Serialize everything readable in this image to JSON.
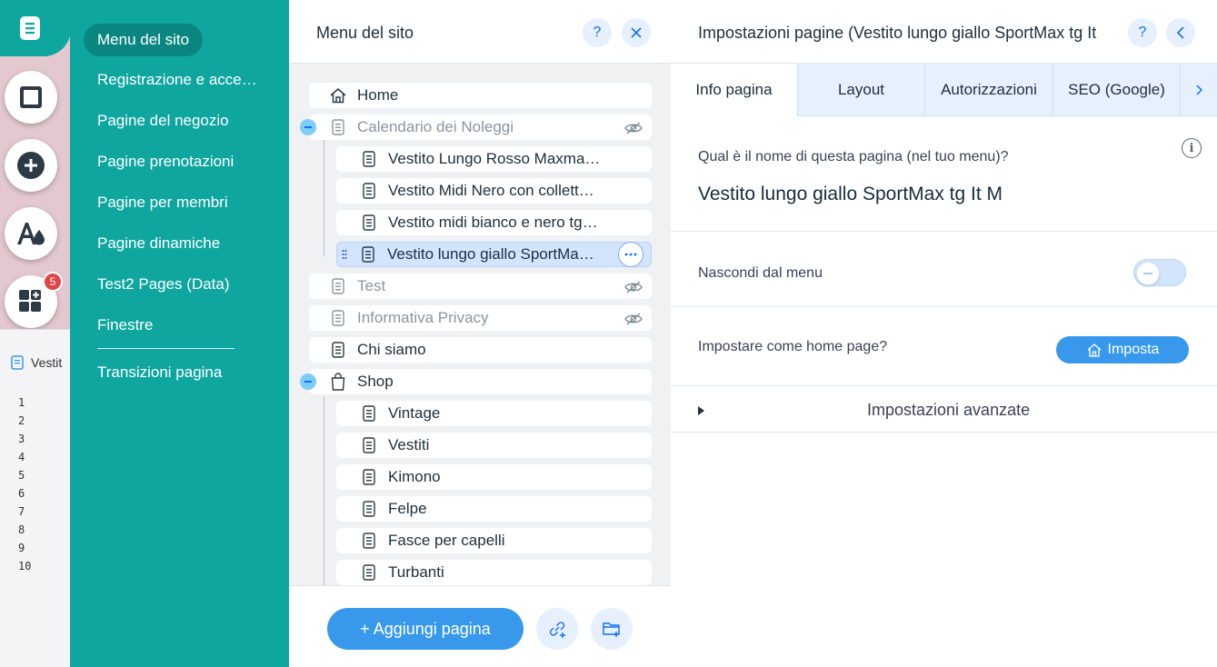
{
  "left_rail": {
    "badge_count": "5",
    "buttons": [
      {
        "name": "pages-menu",
        "icon": "page-icon"
      },
      {
        "name": "design",
        "icon": "square-icon"
      },
      {
        "name": "add",
        "icon": "plus-icon"
      },
      {
        "name": "theme",
        "icon": "font-color-icon"
      },
      {
        "name": "apps",
        "icon": "apps-icon"
      }
    ]
  },
  "code_panel": {
    "tab_label": "Vestit",
    "line_numbers": [
      "1",
      "2",
      "3",
      "4",
      "5",
      "6",
      "7",
      "8",
      "9",
      "10"
    ]
  },
  "teal_nav": {
    "items": [
      "Menu del sito",
      "Registrazione e acce…",
      "Pagine del negozio",
      "Pagine prenotazioni",
      "Pagine per membri",
      "Pagine dinamiche",
      "Test2 Pages (Data)",
      "Finestre",
      "Transizioni pagina"
    ]
  },
  "site_menu": {
    "title": "Menu del sito",
    "help_label": "?",
    "rows": [
      {
        "label": "Home",
        "icon": "home-icon",
        "level": 0,
        "hidden": false
      },
      {
        "label": "Calendario dei Noleggi",
        "icon": "page-icon",
        "level": 0,
        "hidden": true,
        "expanded": true
      },
      {
        "label": "Vestito Lungo Rosso Maxma…",
        "icon": "page-icon",
        "level": 1,
        "hidden": false
      },
      {
        "label": "Vestito Midi Nero con collett…",
        "icon": "page-icon",
        "level": 1,
        "hidden": false
      },
      {
        "label": "Vestito midi bianco e nero tg…",
        "icon": "page-icon",
        "level": 1,
        "hidden": false
      },
      {
        "label": "Vestito lungo giallo SportMa…",
        "icon": "page-icon",
        "level": 1,
        "hidden": false,
        "selected": true
      },
      {
        "label": "Test",
        "icon": "page-icon",
        "level": 0,
        "hidden": true
      },
      {
        "label": "Informativa Privacy",
        "icon": "page-icon",
        "level": 0,
        "hidden": true
      },
      {
        "label": "Chi siamo",
        "icon": "page-icon",
        "level": 0,
        "hidden": false
      },
      {
        "label": "Shop",
        "icon": "bag-icon",
        "level": 0,
        "hidden": false,
        "expanded": true
      },
      {
        "label": "Vintage",
        "icon": "page-icon",
        "level": 1,
        "hidden": false
      },
      {
        "label": "Vestiti",
        "icon": "page-icon",
        "level": 1,
        "hidden": false
      },
      {
        "label": "Kimono",
        "icon": "page-icon",
        "level": 1,
        "hidden": false
      },
      {
        "label": "Felpe",
        "icon": "page-icon",
        "level": 1,
        "hidden": false
      },
      {
        "label": "Fasce per capelli",
        "icon": "page-icon",
        "level": 1,
        "hidden": false
      },
      {
        "label": "Turbanti",
        "icon": "page-icon",
        "level": 1,
        "hidden": false
      }
    ],
    "add_page_label": "+ Aggiungi pagina"
  },
  "page_settings": {
    "title": "Impostazioni pagine (Vestito lungo giallo SportMax tg It",
    "help_label": "?",
    "tabs": [
      "Info pagina",
      "Layout",
      "Autorizzazioni",
      "SEO (Google)"
    ],
    "active_tab": "Info pagina",
    "name_question": "Qual è il nome di questa pagina (nel tuo menu)?",
    "page_name": "Vestito lungo giallo SportMax tg It M",
    "info_label": "i",
    "hide_label": "Nascondi dal menu",
    "hide_toggle_on": false,
    "homepage_question": "Impostare come home page?",
    "set_button_label": "Imposta",
    "advanced_label": "Impostazioni avanzate"
  },
  "colors": {
    "teal": "#0fa6a0",
    "accent_blue": "#3899ec",
    "light_blue": "#e7f0ff",
    "selected_row": "#d3e4ff",
    "badge_red": "#e04646"
  }
}
